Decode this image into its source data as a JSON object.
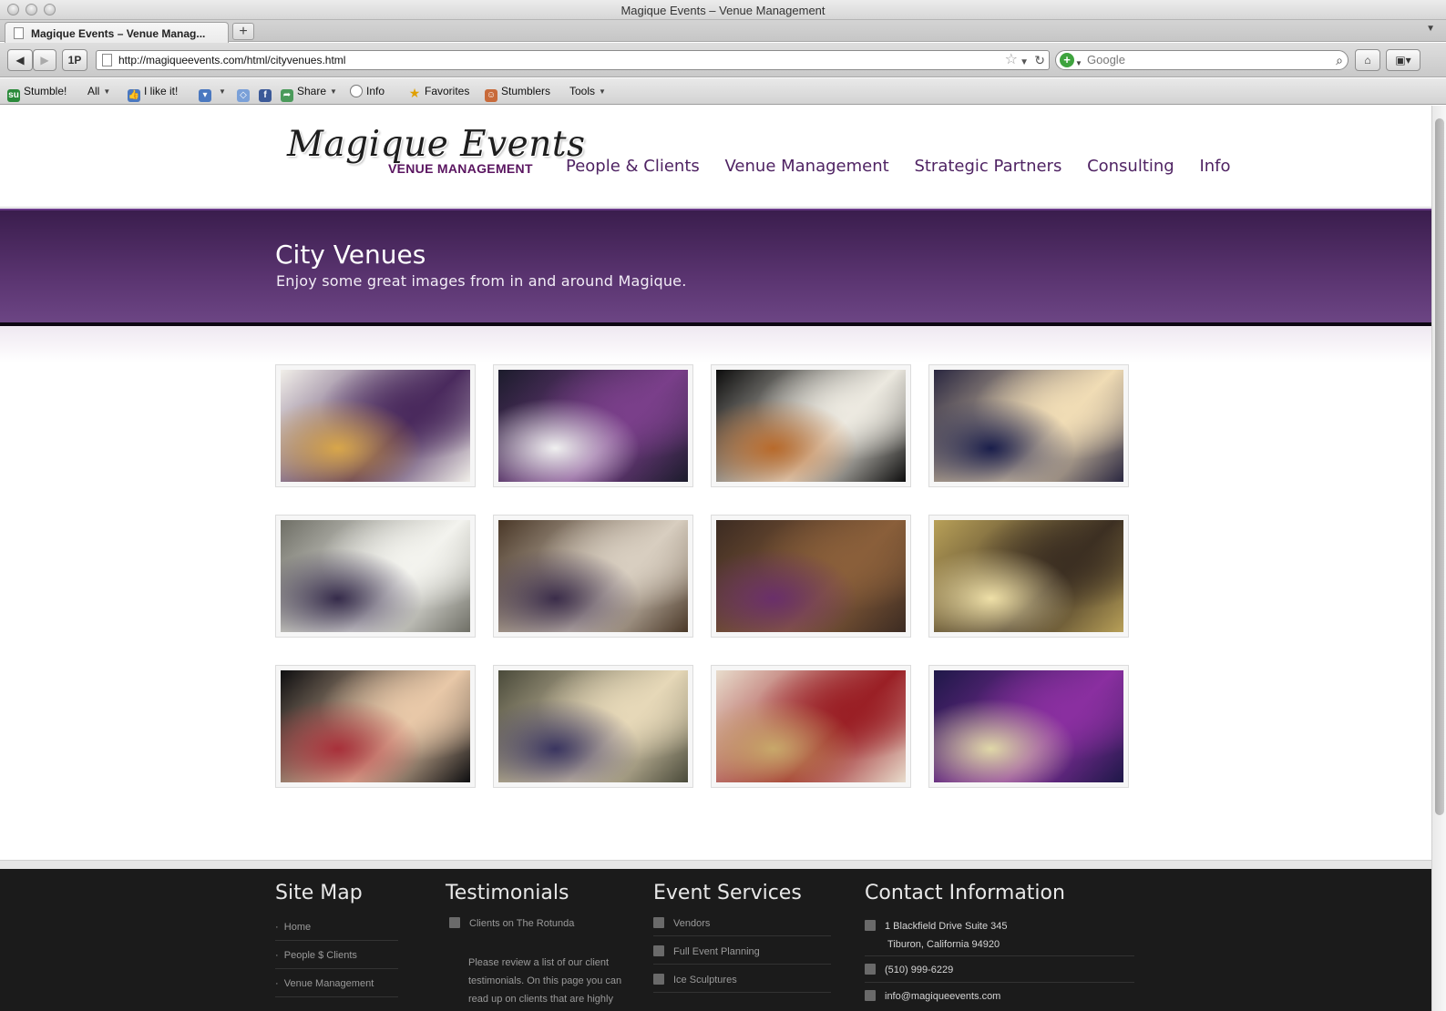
{
  "window": {
    "title": "Magique Events – Venue Management"
  },
  "tabs": [
    {
      "label": "Magique Events – Venue Manag..."
    }
  ],
  "navigation": {
    "url": "http://magiqueevents.com/html/cityvenues.html",
    "onepassword_label": "1P",
    "search_placeholder": "Google"
  },
  "bookmarks": {
    "stumble": "Stumble!",
    "all": "All",
    "like": "I like it!",
    "share": "Share",
    "info": "Info",
    "favorites": "Favorites",
    "stumblers": "Stumblers",
    "tools": "Tools"
  },
  "site": {
    "logo_title": "Magique Events",
    "logo_subtitle": "VENUE MANAGEMENT",
    "nav": [
      "People & Clients",
      "Venue Management",
      "Strategic Partners",
      "Consulting",
      "Info"
    ]
  },
  "hero": {
    "title": "City Venues",
    "subtitle": "Enjoy some great images from in and around Magique."
  },
  "gallery": [
    {
      "desc": "plated-appetizer",
      "colors": [
        "#f1efe9",
        "#4a2a5d",
        "#d8a64a"
      ]
    },
    {
      "desc": "bridal-party",
      "colors": [
        "#1c1c2c",
        "#7a3f8a",
        "#f0f0f0"
      ]
    },
    {
      "desc": "served-plates",
      "colors": [
        "#0d0d0d",
        "#ece9e0",
        "#b86a2b"
      ]
    },
    {
      "desc": "atrium-staircase-crowd",
      "colors": [
        "#2a2740",
        "#f0dcb5",
        "#1a1e4b"
      ]
    },
    {
      "desc": "chefs-plating",
      "colors": [
        "#6f6f66",
        "#f3f3ee",
        "#352b4a"
      ]
    },
    {
      "desc": "first-dance-staircase",
      "colors": [
        "#4a3828",
        "#d8cec0",
        "#3b2d4a"
      ]
    },
    {
      "desc": "balcony-ballroom",
      "colors": [
        "#3c2b22",
        "#8a5f3a",
        "#6a2f6a"
      ]
    },
    {
      "desc": "dome-ballroom",
      "colors": [
        "#b8a058",
        "#3c2f22",
        "#efe0a8"
      ]
    },
    {
      "desc": "groomsmen-group",
      "colors": [
        "#0e0e10",
        "#e8c8a8",
        "#a8303a"
      ]
    },
    {
      "desc": "rotunda-tables-aerial",
      "colors": [
        "#4a4a3a",
        "#e6d8b8",
        "#3a3560"
      ]
    },
    {
      "desc": "dome-ceiling-lamps",
      "colors": [
        "#e8dccc",
        "#9a1f25",
        "#c8a86a"
      ]
    },
    {
      "desc": "dance-floor-party",
      "colors": [
        "#1e1848",
        "#8a2fa0",
        "#e0d8a8"
      ]
    }
  ],
  "footer": {
    "sitemap": {
      "heading": "Site Map",
      "items": [
        "Home",
        "People $ Clients",
        "Venue Management"
      ]
    },
    "testimonials": {
      "heading": "Testimonials",
      "link": "Clients on The Rotunda",
      "text": [
        "Please review a list of our client",
        "testimonials. On this page you can",
        "read up on clients that are highly"
      ]
    },
    "services": {
      "heading": "Event Services",
      "items": [
        "Vendors",
        "Full Event Planning",
        "Ice Sculptures"
      ]
    },
    "contact": {
      "heading": "Contact Information",
      "address1": "1 Blackfield Drive Suite 345",
      "address2": "Tiburon, California 94920",
      "phone": "(510) 999-6229",
      "email": "info@magiqueevents.com"
    }
  },
  "colors": {
    "brand_purple": "#5a3470",
    "nav_text": "#4f2363",
    "footer_bg": "#1b1b1b"
  }
}
